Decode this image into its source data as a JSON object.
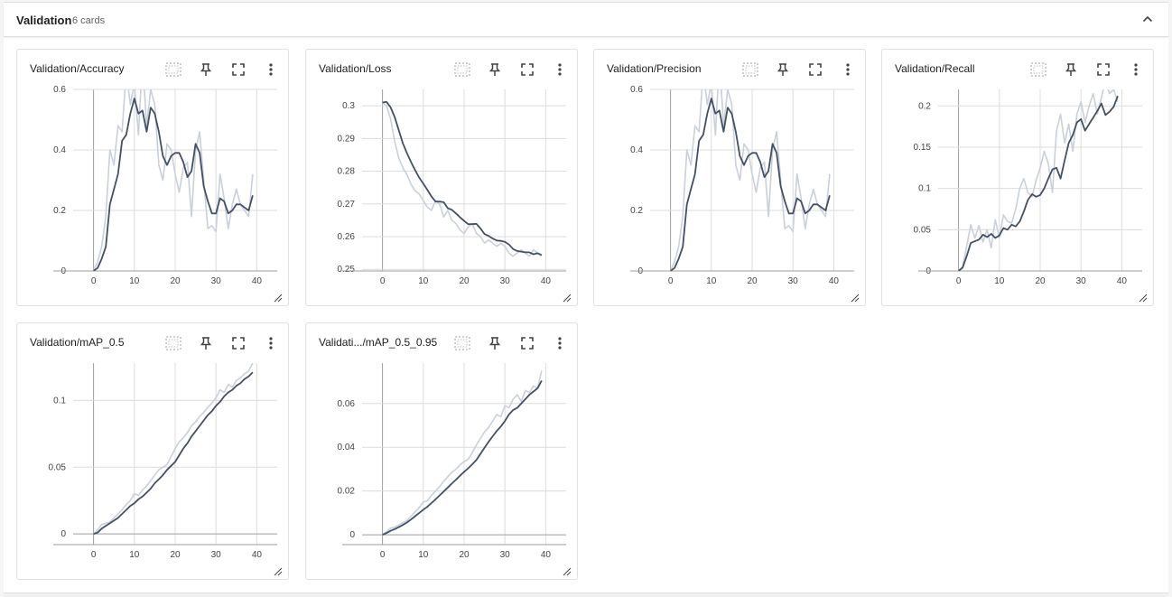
{
  "group": {
    "title": "Validation",
    "count": "6 cards"
  },
  "colors": {
    "smoothed": "#425066",
    "raw": "#c8d0dc",
    "grid": "#dcdcdc",
    "axis": "#9e9e9e"
  },
  "icons": {
    "collapse": "chevron-up-icon",
    "data_selection": "dotted-box-icon",
    "pin": "pin-icon",
    "fullscreen": "fullscreen-icon",
    "more": "more-vert-icon",
    "resize": "resize-handle-icon"
  },
  "chart_data": [
    {
      "type": "line",
      "title": "Validation/Accuracy",
      "xlim": [
        -5,
        45
      ],
      "ylim": [
        0,
        0.6
      ],
      "xticks": [
        0,
        10,
        20,
        30,
        40
      ],
      "yticks": [
        {
          "v": 0,
          "label": "0"
        },
        {
          "v": 0.2,
          "label": "0.2"
        },
        {
          "v": 0.4,
          "label": "0.4"
        },
        {
          "v": 0.6,
          "label": "0.6"
        }
      ],
      "x": [
        0,
        1,
        2,
        3,
        4,
        5,
        6,
        7,
        8,
        9,
        10,
        11,
        12,
        13,
        14,
        15,
        16,
        17,
        18,
        19,
        20,
        21,
        22,
        23,
        24,
        25,
        26,
        27,
        28,
        29,
        30,
        31,
        32,
        33,
        34,
        35,
        36,
        37,
        38,
        39
      ],
      "series": [
        {
          "values": [
            0.0,
            0.03,
            0.08,
            0.18,
            0.4,
            0.35,
            0.48,
            0.46,
            0.66,
            0.55,
            0.62,
            0.45,
            0.7,
            0.48,
            0.6,
            0.55,
            0.35,
            0.3,
            0.42,
            0.4,
            0.32,
            0.26,
            0.34,
            0.36,
            0.18,
            0.4,
            0.46,
            0.3,
            0.14,
            0.15,
            0.13,
            0.32,
            0.24,
            0.14,
            0.22,
            0.27,
            0.22,
            0.2,
            0.18,
            0.32
          ]
        },
        {
          "values": [
            0.0,
            0.01,
            0.04,
            0.08,
            0.22,
            0.27,
            0.32,
            0.43,
            0.45,
            0.52,
            0.57,
            0.52,
            0.53,
            0.46,
            0.54,
            0.52,
            0.46,
            0.38,
            0.35,
            0.38,
            0.39,
            0.39,
            0.36,
            0.31,
            0.33,
            0.42,
            0.39,
            0.28,
            0.23,
            0.19,
            0.19,
            0.24,
            0.23,
            0.19,
            0.2,
            0.22,
            0.22,
            0.21,
            0.2,
            0.25
          ]
        }
      ]
    },
    {
      "type": "line",
      "title": "Validation/Loss",
      "xlim": [
        -5,
        45
      ],
      "ylim": [
        0.2495,
        0.305
      ],
      "xticks": [
        0,
        10,
        20,
        30,
        40
      ],
      "yticks": [
        {
          "v": 0.25,
          "label": "0.25"
        },
        {
          "v": 0.26,
          "label": "0.26"
        },
        {
          "v": 0.27,
          "label": "0.27"
        },
        {
          "v": 0.28,
          "label": "0.28"
        },
        {
          "v": 0.29,
          "label": "0.29"
        },
        {
          "v": 0.3,
          "label": "0.3"
        }
      ],
      "x": [
        0,
        1,
        2,
        3,
        4,
        5,
        6,
        7,
        8,
        9,
        10,
        11,
        12,
        13,
        14,
        15,
        16,
        17,
        18,
        19,
        20,
        21,
        22,
        23,
        24,
        25,
        26,
        27,
        28,
        29,
        30,
        31,
        32,
        33,
        34,
        35,
        36,
        37,
        38,
        39
      ],
      "series": [
        {
          "values": [
            0.301,
            0.3,
            0.296,
            0.289,
            0.284,
            0.281,
            0.279,
            0.276,
            0.274,
            0.273,
            0.271,
            0.269,
            0.268,
            0.271,
            0.27,
            0.266,
            0.268,
            0.265,
            0.264,
            0.262,
            0.261,
            0.263,
            0.264,
            0.261,
            0.26,
            0.258,
            0.259,
            0.258,
            0.257,
            0.258,
            0.257,
            0.255,
            0.254,
            0.255,
            0.256,
            0.255,
            0.254,
            0.256,
            0.255,
            0.254
          ]
        },
        {
          "values": [
            0.301,
            0.3012,
            0.2995,
            0.2965,
            0.2925,
            0.2885,
            0.2855,
            0.2828,
            0.2803,
            0.278,
            0.2762,
            0.2743,
            0.2723,
            0.2707,
            0.2707,
            0.2705,
            0.2687,
            0.2682,
            0.2671,
            0.2659,
            0.2648,
            0.2638,
            0.2638,
            0.2639,
            0.2625,
            0.2608,
            0.2602,
            0.2594,
            0.2588,
            0.2587,
            0.2584,
            0.2576,
            0.2562,
            0.2556,
            0.2554,
            0.2552,
            0.2552,
            0.2546,
            0.2549,
            0.2544
          ]
        }
      ]
    },
    {
      "type": "line",
      "title": "Validation/Precision",
      "xlim": [
        -5,
        45
      ],
      "ylim": [
        0,
        0.6
      ],
      "xticks": [
        0,
        10,
        20,
        30,
        40
      ],
      "yticks": [
        {
          "v": 0,
          "label": "0"
        },
        {
          "v": 0.2,
          "label": "0.2"
        },
        {
          "v": 0.4,
          "label": "0.4"
        },
        {
          "v": 0.6,
          "label": "0.6"
        }
      ],
      "x": [
        0,
        1,
        2,
        3,
        4,
        5,
        6,
        7,
        8,
        9,
        10,
        11,
        12,
        13,
        14,
        15,
        16,
        17,
        18,
        19,
        20,
        21,
        22,
        23,
        24,
        25,
        26,
        27,
        28,
        29,
        30,
        31,
        32,
        33,
        34,
        35,
        36,
        37,
        38,
        39
      ],
      "series": [
        {
          "values": [
            0.0,
            0.03,
            0.08,
            0.18,
            0.4,
            0.35,
            0.48,
            0.46,
            0.66,
            0.55,
            0.62,
            0.45,
            0.7,
            0.48,
            0.6,
            0.55,
            0.35,
            0.3,
            0.42,
            0.4,
            0.32,
            0.26,
            0.34,
            0.36,
            0.18,
            0.4,
            0.46,
            0.3,
            0.14,
            0.15,
            0.13,
            0.32,
            0.24,
            0.14,
            0.22,
            0.27,
            0.22,
            0.2,
            0.18,
            0.32
          ]
        },
        {
          "values": [
            0.0,
            0.01,
            0.04,
            0.08,
            0.22,
            0.27,
            0.32,
            0.43,
            0.45,
            0.52,
            0.57,
            0.52,
            0.53,
            0.46,
            0.54,
            0.52,
            0.46,
            0.38,
            0.35,
            0.38,
            0.39,
            0.39,
            0.36,
            0.31,
            0.33,
            0.42,
            0.39,
            0.28,
            0.23,
            0.19,
            0.19,
            0.24,
            0.23,
            0.19,
            0.2,
            0.22,
            0.22,
            0.21,
            0.2,
            0.25
          ]
        }
      ]
    },
    {
      "type": "line",
      "title": "Validation/Recall",
      "xlim": [
        -5,
        45
      ],
      "ylim": [
        0,
        0.22
      ],
      "xticks": [
        0,
        10,
        20,
        30,
        40
      ],
      "yticks": [
        {
          "v": 0,
          "label": "0"
        },
        {
          "v": 0.05,
          "label": "0.05"
        },
        {
          "v": 0.1,
          "label": "0.1"
        },
        {
          "v": 0.15,
          "label": "0.15"
        },
        {
          "v": 0.2,
          "label": "0.2"
        }
      ],
      "x": [
        0,
        1,
        2,
        3,
        4,
        5,
        6,
        7,
        8,
        9,
        10,
        11,
        12,
        13,
        14,
        15,
        16,
        17,
        18,
        19,
        20,
        21,
        22,
        23,
        24,
        25,
        26,
        27,
        28,
        29,
        30,
        31,
        32,
        33,
        34,
        35,
        36,
        37,
        38,
        39
      ],
      "series": [
        {
          "values": [
            0.0,
            0.005,
            0.03,
            0.056,
            0.04,
            0.055,
            0.035,
            0.05,
            0.028,
            0.062,
            0.04,
            0.068,
            0.06,
            0.058,
            0.075,
            0.1,
            0.112,
            0.095,
            0.09,
            0.11,
            0.125,
            0.145,
            0.13,
            0.095,
            0.17,
            0.19,
            0.155,
            0.178,
            0.145,
            0.19,
            0.205,
            0.18,
            0.2,
            0.215,
            0.19,
            0.21,
            0.23,
            0.215,
            0.22,
            0.205
          ]
        },
        {
          "values": [
            0.0,
            0.004,
            0.018,
            0.034,
            0.036,
            0.038,
            0.044,
            0.041,
            0.045,
            0.04,
            0.043,
            0.052,
            0.05,
            0.056,
            0.054,
            0.06,
            0.072,
            0.086,
            0.093,
            0.09,
            0.092,
            0.1,
            0.112,
            0.123,
            0.125,
            0.112,
            0.134,
            0.155,
            0.165,
            0.18,
            0.184,
            0.17,
            0.178,
            0.186,
            0.194,
            0.203,
            0.189,
            0.193,
            0.199,
            0.212
          ]
        }
      ]
    },
    {
      "type": "line",
      "title": "Validation/mAP_0.5",
      "xlim": [
        -5,
        45
      ],
      "ylim": [
        -0.008,
        0.128
      ],
      "xticks": [
        0,
        10,
        20,
        30,
        40
      ],
      "yticks": [
        {
          "v": 0,
          "label": "0"
        },
        {
          "v": 0.05,
          "label": "0.05"
        },
        {
          "v": 0.1,
          "label": "0.1"
        }
      ],
      "x": [
        0,
        1,
        2,
        3,
        4,
        5,
        6,
        7,
        8,
        9,
        10,
        11,
        12,
        13,
        14,
        15,
        16,
        17,
        18,
        19,
        20,
        21,
        22,
        23,
        24,
        25,
        26,
        27,
        28,
        29,
        30,
        31,
        32,
        33,
        34,
        35,
        36,
        37,
        38,
        39
      ],
      "series": [
        {
          "values": [
            0.0,
            0.003,
            0.007,
            0.008,
            0.009,
            0.012,
            0.015,
            0.018,
            0.022,
            0.025,
            0.03,
            0.029,
            0.033,
            0.036,
            0.04,
            0.044,
            0.048,
            0.05,
            0.052,
            0.058,
            0.064,
            0.069,
            0.072,
            0.076,
            0.081,
            0.084,
            0.088,
            0.091,
            0.095,
            0.098,
            0.102,
            0.108,
            0.106,
            0.112,
            0.11,
            0.115,
            0.117,
            0.12,
            0.122,
            0.128
          ]
        },
        {
          "values": [
            0.0,
            0.001,
            0.004,
            0.006,
            0.008,
            0.01,
            0.012,
            0.015,
            0.018,
            0.021,
            0.023,
            0.026,
            0.028,
            0.031,
            0.034,
            0.038,
            0.041,
            0.044,
            0.048,
            0.051,
            0.054,
            0.059,
            0.064,
            0.068,
            0.073,
            0.077,
            0.081,
            0.085,
            0.089,
            0.092,
            0.096,
            0.099,
            0.103,
            0.106,
            0.108,
            0.111,
            0.113,
            0.116,
            0.118,
            0.121
          ]
        }
      ]
    },
    {
      "type": "line",
      "title": "Validati.../mAP_0.5_0.95",
      "xlim": [
        -5,
        45
      ],
      "ylim": [
        -0.0045,
        0.0785
      ],
      "xticks": [
        0,
        10,
        20,
        30,
        40
      ],
      "yticks": [
        {
          "v": 0,
          "label": "0"
        },
        {
          "v": 0.02,
          "label": "0.02"
        },
        {
          "v": 0.04,
          "label": "0.04"
        },
        {
          "v": 0.06,
          "label": "0.06"
        }
      ],
      "x": [
        0,
        1,
        2,
        3,
        4,
        5,
        6,
        7,
        8,
        9,
        10,
        11,
        12,
        13,
        14,
        15,
        16,
        17,
        18,
        19,
        20,
        21,
        22,
        23,
        24,
        25,
        26,
        27,
        28,
        29,
        30,
        31,
        32,
        33,
        34,
        35,
        36,
        37,
        38,
        39
      ],
      "series": [
        {
          "values": [
            0.0,
            0.0015,
            0.003,
            0.0035,
            0.0045,
            0.0055,
            0.0065,
            0.0085,
            0.0105,
            0.0125,
            0.015,
            0.0155,
            0.018,
            0.02,
            0.022,
            0.0245,
            0.0265,
            0.0285,
            0.03,
            0.032,
            0.0335,
            0.0345,
            0.0375,
            0.041,
            0.044,
            0.047,
            0.049,
            0.052,
            0.055,
            0.054,
            0.059,
            0.058,
            0.062,
            0.064,
            0.061,
            0.066,
            0.065,
            0.068,
            0.067,
            0.075
          ]
        },
        {
          "values": [
            0.0,
            0.0008,
            0.0018,
            0.0026,
            0.0035,
            0.0045,
            0.0056,
            0.007,
            0.0085,
            0.01,
            0.0115,
            0.0128,
            0.0145,
            0.0162,
            0.018,
            0.0198,
            0.0216,
            0.0234,
            0.0252,
            0.027,
            0.0288,
            0.0304,
            0.0322,
            0.0342,
            0.037,
            0.0398,
            0.0425,
            0.045,
            0.0475,
            0.0495,
            0.052,
            0.055,
            0.057,
            0.058,
            0.06,
            0.062,
            0.064,
            0.0655,
            0.067,
            0.0705
          ]
        }
      ]
    }
  ]
}
